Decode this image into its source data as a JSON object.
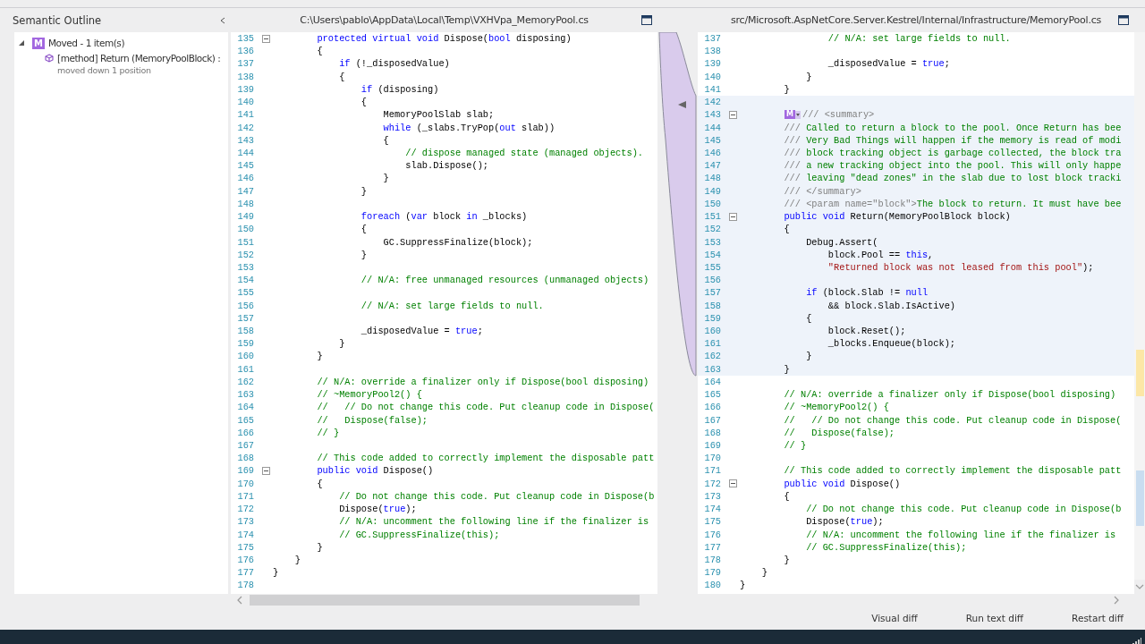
{
  "sidebar": {
    "title": "Semantic Outline",
    "tree": [
      {
        "badge": "M",
        "label": "Moved - 1 item(s)",
        "expanded": true,
        "children": [
          {
            "label": "[method] Return (MemoryPoolBlock) :",
            "detail": "moved down 1 position"
          }
        ]
      }
    ]
  },
  "left_pane": {
    "title": "C:\\Users\\pablo\\AppData\\Local\\Temp\\VXHVpa_MemoryPool.cs",
    "lines": [
      {
        "n": "135",
        "fold": true,
        "s": [
          {
            "kind": "keyword",
            "text": "        protected virtual void"
          },
          {
            "kind": "plain",
            "text": " Dispose("
          },
          {
            "kind": "keyword",
            "text": "bool"
          },
          {
            "kind": "plain",
            "text": " disposing)"
          }
        ]
      },
      {
        "n": "136",
        "s": [
          {
            "kind": "plain",
            "text": "        {"
          }
        ]
      },
      {
        "n": "137",
        "s": [
          {
            "kind": "keyword",
            "text": "            if"
          },
          {
            "kind": "plain",
            "text": " (!_disposedValue)"
          }
        ]
      },
      {
        "n": "138",
        "s": [
          {
            "kind": "plain",
            "text": "            {"
          }
        ]
      },
      {
        "n": "139",
        "s": [
          {
            "kind": "keyword",
            "text": "                if"
          },
          {
            "kind": "plain",
            "text": " (disposing)"
          }
        ]
      },
      {
        "n": "140",
        "s": [
          {
            "kind": "plain",
            "text": "                {"
          }
        ]
      },
      {
        "n": "141",
        "s": [
          {
            "kind": "plain",
            "text": "                    MemoryPoolSlab slab;"
          }
        ]
      },
      {
        "n": "142",
        "s": [
          {
            "kind": "keyword",
            "text": "                    while"
          },
          {
            "kind": "plain",
            "text": " (_slabs.TryPop("
          },
          {
            "kind": "keyword",
            "text": "out"
          },
          {
            "kind": "plain",
            "text": " slab))"
          }
        ]
      },
      {
        "n": "143",
        "s": [
          {
            "kind": "plain",
            "text": "                    {"
          }
        ]
      },
      {
        "n": "144",
        "s": [
          {
            "kind": "comment",
            "text": "                        // dispose managed state (managed objects)."
          }
        ]
      },
      {
        "n": "145",
        "s": [
          {
            "kind": "plain",
            "text": "                        slab.Dispose();"
          }
        ]
      },
      {
        "n": "146",
        "s": [
          {
            "kind": "plain",
            "text": "                    }"
          }
        ]
      },
      {
        "n": "147",
        "s": [
          {
            "kind": "plain",
            "text": "                }"
          }
        ]
      },
      {
        "n": "148"
      },
      {
        "n": "149",
        "s": [
          {
            "kind": "keyword",
            "text": "                foreach"
          },
          {
            "kind": "plain",
            "text": " ("
          },
          {
            "kind": "keyword",
            "text": "var"
          },
          {
            "kind": "plain",
            "text": " block "
          },
          {
            "kind": "keyword",
            "text": "in"
          },
          {
            "kind": "plain",
            "text": " _blocks)"
          }
        ]
      },
      {
        "n": "150",
        "s": [
          {
            "kind": "plain",
            "text": "                {"
          }
        ]
      },
      {
        "n": "151",
        "s": [
          {
            "kind": "plain",
            "text": "                    GC.SuppressFinalize(block);"
          }
        ]
      },
      {
        "n": "152",
        "s": [
          {
            "kind": "plain",
            "text": "                }"
          }
        ]
      },
      {
        "n": "153"
      },
      {
        "n": "154",
        "s": [
          {
            "kind": "comment",
            "text": "                // N/A: free unmanaged resources (unmanaged objects)"
          }
        ]
      },
      {
        "n": "155"
      },
      {
        "n": "156",
        "s": [
          {
            "kind": "comment",
            "text": "                // N/A: set large fields to null."
          }
        ]
      },
      {
        "n": "157"
      },
      {
        "n": "158",
        "s": [
          {
            "kind": "plain",
            "text": "                _disposedValue = "
          },
          {
            "kind": "keyword",
            "text": "true"
          },
          {
            "kind": "plain",
            "text": ";"
          }
        ]
      },
      {
        "n": "159",
        "s": [
          {
            "kind": "plain",
            "text": "            }"
          }
        ]
      },
      {
        "n": "160",
        "s": [
          {
            "kind": "plain",
            "text": "        }"
          }
        ]
      },
      {
        "n": "161"
      },
      {
        "n": "162",
        "s": [
          {
            "kind": "comment",
            "text": "        // N/A: override a finalizer only if Dispose(bool disposing)"
          }
        ]
      },
      {
        "n": "163",
        "s": [
          {
            "kind": "comment",
            "text": "        // ~MemoryPool2() {"
          }
        ]
      },
      {
        "n": "164",
        "s": [
          {
            "kind": "comment",
            "text": "        //   // Do not change this code. Put cleanup code in Dispose("
          }
        ]
      },
      {
        "n": "165",
        "s": [
          {
            "kind": "comment",
            "text": "        //   Dispose(false);"
          }
        ]
      },
      {
        "n": "166",
        "s": [
          {
            "kind": "comment",
            "text": "        // }"
          }
        ]
      },
      {
        "n": "167"
      },
      {
        "n": "168",
        "s": [
          {
            "kind": "comment",
            "text": "        // This code added to correctly implement the disposable patt"
          }
        ]
      },
      {
        "n": "169",
        "fold": true,
        "s": [
          {
            "kind": "keyword",
            "text": "        public void"
          },
          {
            "kind": "plain",
            "text": " Dispose()"
          }
        ]
      },
      {
        "n": "170",
        "s": [
          {
            "kind": "plain",
            "text": "        {"
          }
        ]
      },
      {
        "n": "171",
        "s": [
          {
            "kind": "comment",
            "text": "            // Do not change this code. Put cleanup code in Dispose(b"
          }
        ]
      },
      {
        "n": "172",
        "s": [
          {
            "kind": "plain",
            "text": "            Dispose("
          },
          {
            "kind": "keyword",
            "text": "true"
          },
          {
            "kind": "plain",
            "text": ");"
          }
        ]
      },
      {
        "n": "173",
        "s": [
          {
            "kind": "comment",
            "text": "            // N/A: uncomment the following line if the finalizer is"
          }
        ]
      },
      {
        "n": "174",
        "s": [
          {
            "kind": "comment",
            "text": "            // GC.SuppressFinalize(this);"
          }
        ]
      },
      {
        "n": "175",
        "s": [
          {
            "kind": "plain",
            "text": "        }"
          }
        ]
      },
      {
        "n": "176",
        "s": [
          {
            "kind": "plain",
            "text": "    }"
          }
        ]
      },
      {
        "n": "177",
        "s": [
          {
            "kind": "plain",
            "text": "}"
          }
        ]
      },
      {
        "n": "178"
      }
    ]
  },
  "right_pane": {
    "title": "src/Microsoft.AspNetCore.Server.Kestrel/Internal/Infrastructure/MemoryPool.cs",
    "lines": [
      {
        "n": "137",
        "s": [
          {
            "kind": "comment",
            "text": "                // N/A: set large fields to null."
          }
        ]
      },
      {
        "n": "138"
      },
      {
        "n": "139",
        "s": [
          {
            "kind": "plain",
            "text": "                _disposedValue = "
          },
          {
            "kind": "keyword",
            "text": "true"
          },
          {
            "kind": "plain",
            "text": ";"
          }
        ]
      },
      {
        "n": "140",
        "s": [
          {
            "kind": "plain",
            "text": "            }"
          }
        ]
      },
      {
        "n": "141",
        "s": [
          {
            "kind": "plain",
            "text": "        }"
          }
        ]
      },
      {
        "n": "142",
        "changed": true
      },
      {
        "n": "143",
        "changed": true,
        "fold": true,
        "badge": "M",
        "s": [
          {
            "kind": "doc",
            "text": "/// <summary>"
          }
        ]
      },
      {
        "n": "144",
        "changed": true,
        "s": [
          {
            "kind": "doc",
            "text": "        /// "
          },
          {
            "kind": "comment",
            "text": "Called to return a block to the pool. Once Return has bee"
          }
        ]
      },
      {
        "n": "145",
        "changed": true,
        "s": [
          {
            "kind": "doc",
            "text": "        /// "
          },
          {
            "kind": "comment",
            "text": "Very Bad Things will happen if the memory is read of modi"
          }
        ]
      },
      {
        "n": "146",
        "changed": true,
        "s": [
          {
            "kind": "doc",
            "text": "        /// "
          },
          {
            "kind": "comment",
            "text": "block tracking object is garbage collected, the block tra"
          }
        ]
      },
      {
        "n": "147",
        "changed": true,
        "s": [
          {
            "kind": "doc",
            "text": "        /// "
          },
          {
            "kind": "comment",
            "text": "a new tracking object into the pool. This will only happe"
          }
        ]
      },
      {
        "n": "148",
        "changed": true,
        "s": [
          {
            "kind": "doc",
            "text": "        /// "
          },
          {
            "kind": "comment",
            "text": "leaving \"dead zones\" in the slab due to lost block tracki"
          }
        ]
      },
      {
        "n": "149",
        "changed": true,
        "s": [
          {
            "kind": "doc",
            "text": "        /// </summary>"
          }
        ]
      },
      {
        "n": "150",
        "changed": true,
        "s": [
          {
            "kind": "doc",
            "text": "        /// <param name=\"block\">"
          },
          {
            "kind": "comment",
            "text": "The block to return. It must have bee"
          }
        ]
      },
      {
        "n": "151",
        "changed": true,
        "fold": true,
        "s": [
          {
            "kind": "keyword",
            "text": "        public void"
          },
          {
            "kind": "plain",
            "text": " Return(MemoryPoolBlock block)"
          }
        ]
      },
      {
        "n": "152",
        "changed": true,
        "s": [
          {
            "kind": "plain",
            "text": "        {"
          }
        ]
      },
      {
        "n": "153",
        "changed": true,
        "s": [
          {
            "kind": "plain",
            "text": "            Debug.Assert("
          }
        ]
      },
      {
        "n": "154",
        "changed": true,
        "s": [
          {
            "kind": "plain",
            "text": "                block.Pool == "
          },
          {
            "kind": "keyword",
            "text": "this"
          },
          {
            "kind": "plain",
            "text": ","
          }
        ]
      },
      {
        "n": "155",
        "changed": true,
        "s": [
          {
            "kind": "string",
            "text": "                \"Returned block was not leased from this pool\""
          },
          {
            "kind": "plain",
            "text": ");"
          }
        ]
      },
      {
        "n": "156",
        "changed": true
      },
      {
        "n": "157",
        "changed": true,
        "s": [
          {
            "kind": "keyword",
            "text": "            if"
          },
          {
            "kind": "plain",
            "text": " (block.Slab != "
          },
          {
            "kind": "keyword",
            "text": "null"
          }
        ]
      },
      {
        "n": "158",
        "changed": true,
        "s": [
          {
            "kind": "plain",
            "text": "                && block.Slab.IsActive)"
          }
        ]
      },
      {
        "n": "159",
        "changed": true,
        "s": [
          {
            "kind": "plain",
            "text": "            {"
          }
        ]
      },
      {
        "n": "160",
        "changed": true,
        "s": [
          {
            "kind": "plain",
            "text": "                block.Reset();"
          }
        ]
      },
      {
        "n": "161",
        "changed": true,
        "s": [
          {
            "kind": "plain",
            "text": "                _blocks.Enqueue(block);"
          }
        ]
      },
      {
        "n": "162",
        "changed": true,
        "s": [
          {
            "kind": "plain",
            "text": "            }"
          }
        ]
      },
      {
        "n": "163",
        "changed": true,
        "s": [
          {
            "kind": "plain",
            "text": "        }"
          }
        ]
      },
      {
        "n": "164"
      },
      {
        "n": "165",
        "s": [
          {
            "kind": "comment",
            "text": "        // N/A: override a finalizer only if Dispose(bool disposing)"
          }
        ]
      },
      {
        "n": "166",
        "s": [
          {
            "kind": "comment",
            "text": "        // ~MemoryPool2() {"
          }
        ]
      },
      {
        "n": "167",
        "s": [
          {
            "kind": "comment",
            "text": "        //   // Do not change this code. Put cleanup code in Dispose("
          }
        ]
      },
      {
        "n": "168",
        "s": [
          {
            "kind": "comment",
            "text": "        //   Dispose(false);"
          }
        ]
      },
      {
        "n": "169",
        "s": [
          {
            "kind": "comment",
            "text": "        // }"
          }
        ]
      },
      {
        "n": "170"
      },
      {
        "n": "171",
        "s": [
          {
            "kind": "comment",
            "text": "        // This code added to correctly implement the disposable patt"
          }
        ]
      },
      {
        "n": "172",
        "fold": true,
        "s": [
          {
            "kind": "keyword",
            "text": "        public void"
          },
          {
            "kind": "plain",
            "text": " Dispose()"
          }
        ]
      },
      {
        "n": "173",
        "s": [
          {
            "kind": "plain",
            "text": "        {"
          }
        ]
      },
      {
        "n": "174",
        "s": [
          {
            "kind": "comment",
            "text": "            // Do not change this code. Put cleanup code in Dispose(b"
          }
        ]
      },
      {
        "n": "175",
        "s": [
          {
            "kind": "plain",
            "text": "            Dispose("
          },
          {
            "kind": "keyword",
            "text": "true"
          },
          {
            "kind": "plain",
            "text": ");"
          }
        ]
      },
      {
        "n": "176",
        "s": [
          {
            "kind": "comment",
            "text": "            // N/A: uncomment the following line if the finalizer is"
          }
        ]
      },
      {
        "n": "177",
        "s": [
          {
            "kind": "comment",
            "text": "            // GC.SuppressFinalize(this);"
          }
        ]
      },
      {
        "n": "178",
        "s": [
          {
            "kind": "plain",
            "text": "        }"
          }
        ]
      },
      {
        "n": "179",
        "s": [
          {
            "kind": "plain",
            "text": "    }"
          }
        ]
      },
      {
        "n": "180",
        "s": [
          {
            "kind": "plain",
            "text": "}"
          }
        ]
      }
    ]
  },
  "buttons": [
    "Visual diff",
    "Run text diff",
    "Restart diff"
  ]
}
